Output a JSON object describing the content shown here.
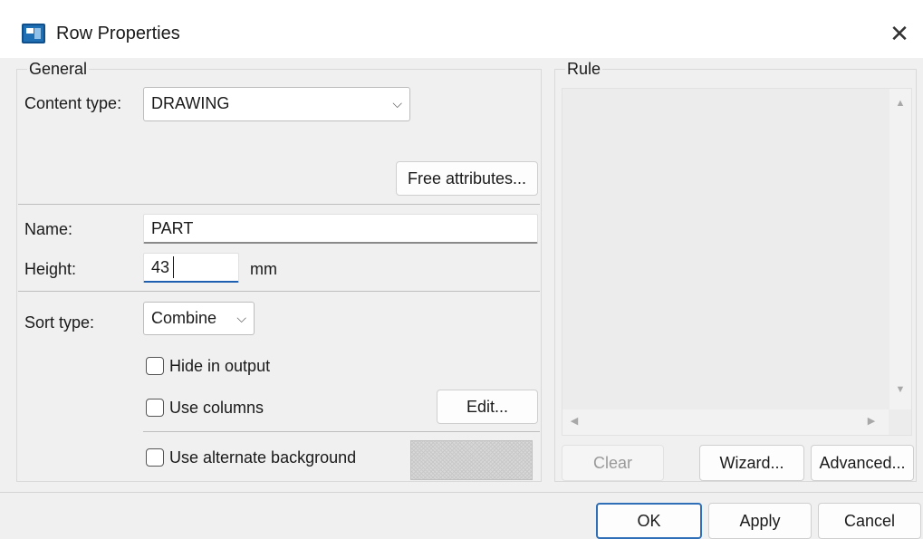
{
  "window": {
    "title": "Row Properties",
    "close_glyph": "✕"
  },
  "general": {
    "group_label": "General",
    "content_type_label": "Content type:",
    "content_type_value": "DRAWING",
    "free_attributes_button": "Free attributes...",
    "name_label": "Name:",
    "name_value": "PART",
    "height_label": "Height:",
    "height_value": "43",
    "height_unit": "mm",
    "sort_type_label": "Sort type:",
    "sort_type_value": "Combine",
    "hide_in_output_label": "Hide in output",
    "hide_in_output_checked": false,
    "use_columns_label": "Use columns",
    "use_columns_checked": false,
    "edit_button": "Edit...",
    "use_alternate_background_label": "Use alternate background",
    "use_alternate_background_checked": false
  },
  "rule": {
    "group_label": "Rule",
    "clear_button": "Clear",
    "wizard_button": "Wizard...",
    "advanced_button": "Advanced..."
  },
  "footer": {
    "ok_button": "OK",
    "apply_button": "Apply",
    "cancel_button": "Cancel"
  },
  "icons": {
    "window_icon": "row-properties-app-icon",
    "close": "close-icon",
    "dropdown": "chevron-down-icon",
    "scroll_up": "scroll-up-arrow-icon",
    "scroll_down": "scroll-down-arrow-icon",
    "scroll_left": "scroll-left-arrow-icon",
    "scroll_right": "scroll-right-arrow-icon"
  }
}
